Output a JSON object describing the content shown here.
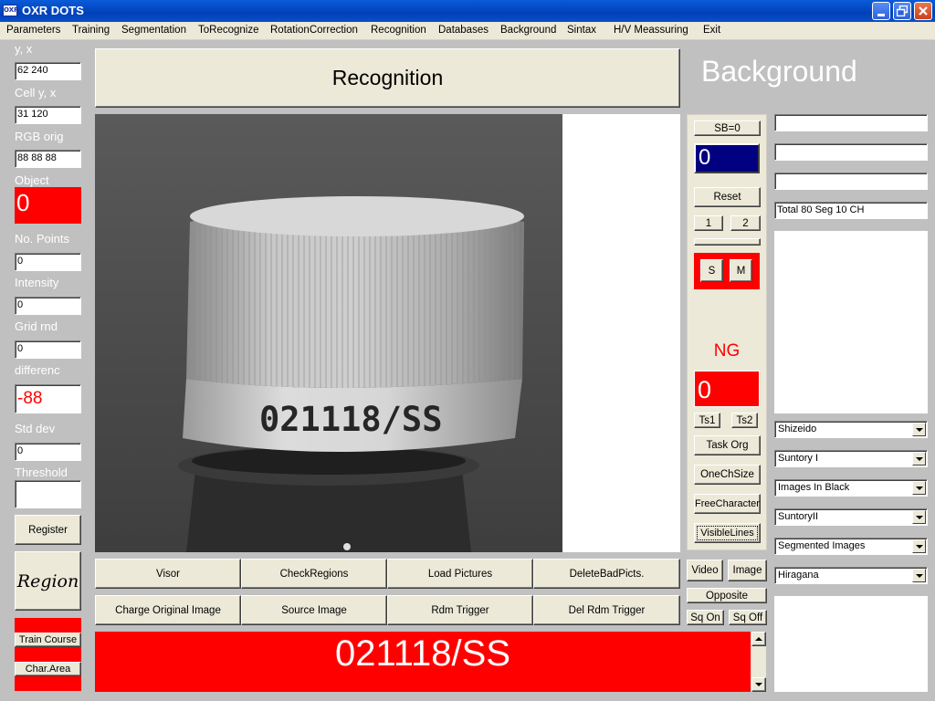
{
  "window": {
    "icon_text": "OXR",
    "title": "OXR DOTS"
  },
  "menu": [
    "Parameters",
    "Training",
    "Segmentation",
    "ToRecognize",
    "RotationCorrection",
    "Recognition",
    "Databases",
    "Background",
    "Sintax",
    "H/V Meassuring",
    "Exit"
  ],
  "left_panel": {
    "yx_label": "y, x",
    "yx_value": "62 240",
    "cell_label": "Cell y, x",
    "cell_value": "31 120",
    "rgb_label": "RGB orig",
    "rgb_value": "88 88 88",
    "object_label": "Object",
    "object_value": "0",
    "points_label": "No. Points",
    "points_value": "0",
    "intensity_label": "Intensity",
    "intensity_value": "0",
    "grid_label": "Grid rnd",
    "grid_value": "0",
    "diff_label": "differenc",
    "diff_value": "-88",
    "std_label": "Std dev",
    "std_value": "0",
    "threshold_label": "Threshold",
    "threshold_value": "",
    "register_label": "Register",
    "region_label": "Region",
    "train_course_label": "Train Course",
    "char_area_label": "Char.Area"
  },
  "header": {
    "recognition_label": "Recognition",
    "background_label": "Background"
  },
  "camera": {
    "cap_text": "021118/SS"
  },
  "controls": {
    "sb_label": "SB=0",
    "sb_value": "0",
    "reset_label": "Reset",
    "btn1": "1",
    "btn2": "2",
    "s_label": "S",
    "m_label": "M",
    "status_text": "NG",
    "ng_value": "0",
    "ts1": "Ts1",
    "ts2": "Ts2",
    "task_org": "Task Org",
    "one_ch_size": "OneChSize",
    "free_character": "FreeCharacter",
    "visible_lines": "VisibleLines",
    "video": "Video",
    "image": "Image",
    "opposite": "Opposite",
    "sq_on": "Sq On",
    "sq_off": "Sq Off"
  },
  "bottom_buttons": {
    "visor": "Visor",
    "check_regions": "CheckRegions",
    "load_pictures": "Load Pictures",
    "delete_bad": "DeleteBadPicts.",
    "charge_original": "Charge Original Image",
    "source_image": "Source Image",
    "rdm_trigger": "Rdm Trigger",
    "del_rdm_trigger": "Del Rdm Trigger"
  },
  "result": {
    "text": "021118/SS"
  },
  "right_panel": {
    "info_line": "Total 80  Seg 10  CH",
    "combo1": "Shizeido",
    "combo2": "Suntory I",
    "combo3": "Images In Black",
    "combo4": "SuntoryII",
    "combo5": "Segmented Images",
    "combo6": "Hiragana"
  },
  "colors": {
    "red": "#ff0000",
    "navy": "#000080",
    "face": "#ece9d8",
    "background": "#c0c0c0"
  }
}
